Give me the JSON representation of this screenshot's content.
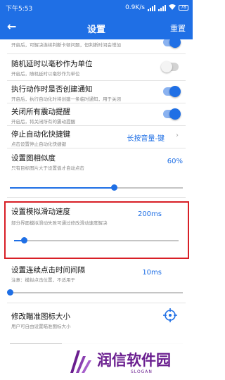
{
  "status_bar": {
    "time": "下午5:53",
    "network_speed": "0.9K/s",
    "battery": "78"
  },
  "app_bar": {
    "back_icon": "back-arrow-icon",
    "title": "设置",
    "reset_label": "重置"
  },
  "settings": [
    {
      "id": "top",
      "description": "开启后，可解决连续判断卡顿问题，但判断时间会增加",
      "toggle": "on"
    },
    {
      "id": "random-ms",
      "title": "随机延时以毫秒作为单位",
      "description": "开启后，随机延时以毫秒作为单位",
      "toggle": "off"
    },
    {
      "id": "notify",
      "title": "执行动作时是否创建通知",
      "description": "开启后，执行自动化时将创建一条临时通知，用于关闭",
      "toggle": "on"
    },
    {
      "id": "vibrate",
      "title": "关闭所有震动提醒",
      "description": "开启后，将关闭所有的震动提醒",
      "toggle": "on"
    },
    {
      "id": "stop-shortcut",
      "title": "停止自动化快捷键",
      "description": "点击设置停止自动化快捷键",
      "value": "长按音量-键"
    },
    {
      "id": "similarity",
      "title": "设置图相似度",
      "description": "只有目标图片大于设置值才自动点击",
      "value": "60%",
      "level": 0.6
    },
    {
      "id": "swipe-speed",
      "title": "设置模拟滑动速度",
      "description": "部分界面模拟滑动失败可通过修改滑动速度解决",
      "value": "200ms",
      "level": 0.06
    },
    {
      "id": "click-interval",
      "title": "设置连续点击时间间隔",
      "description": "注意：模拟点击位置，不适用于",
      "value": "10ms",
      "level": 0.0
    },
    {
      "id": "crosshair-size",
      "title": "修改瞄准图标大小",
      "description": "用户可自由设置瞄准图标大小",
      "icon": "crosshair-icon"
    }
  ],
  "watermark": {
    "brand": "润信软件园",
    "slogan": "SLOGAN"
  },
  "colors": {
    "accent": "#1f6fe5",
    "highlight": "#d81f26",
    "watermark": "#6a1e8f"
  }
}
